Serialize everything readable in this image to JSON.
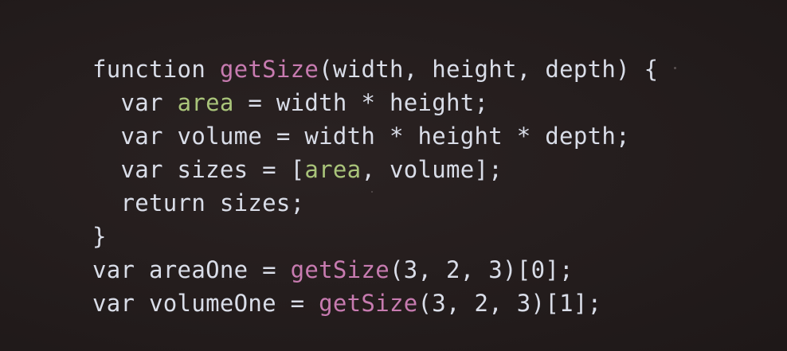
{
  "colors": {
    "background": "#241d1d",
    "plain": "#d9dde8",
    "function_name": "#c77bb0",
    "variable_name": "#a9c47a"
  },
  "code": {
    "lines": [
      [
        {
          "t": "function ",
          "k": "plain"
        },
        {
          "t": "getSize",
          "k": "fn"
        },
        {
          "t": "(width, height, depth) {",
          "k": "plain"
        }
      ],
      [
        {
          "t": "  var ",
          "k": "plain"
        },
        {
          "t": "area",
          "k": "var"
        },
        {
          "t": " = width * height;",
          "k": "plain"
        }
      ],
      [
        {
          "t": "  var volume = width * height * depth;",
          "k": "plain"
        }
      ],
      [
        {
          "t": "  var sizes = [",
          "k": "plain"
        },
        {
          "t": "area",
          "k": "var"
        },
        {
          "t": ", volume];",
          "k": "plain"
        }
      ],
      [
        {
          "t": "  return sizes;",
          "k": "plain"
        }
      ],
      [
        {
          "t": "}",
          "k": "plain"
        }
      ],
      [
        {
          "t": "var areaOne = ",
          "k": "plain"
        },
        {
          "t": "getSize",
          "k": "fn"
        },
        {
          "t": "(3, 2, 3)[0];",
          "k": "plain"
        }
      ],
      [
        {
          "t": "var volumeOne = ",
          "k": "plain"
        },
        {
          "t": "getSize",
          "k": "fn"
        },
        {
          "t": "(3, 2, 3)[1];",
          "k": "plain"
        }
      ]
    ]
  }
}
